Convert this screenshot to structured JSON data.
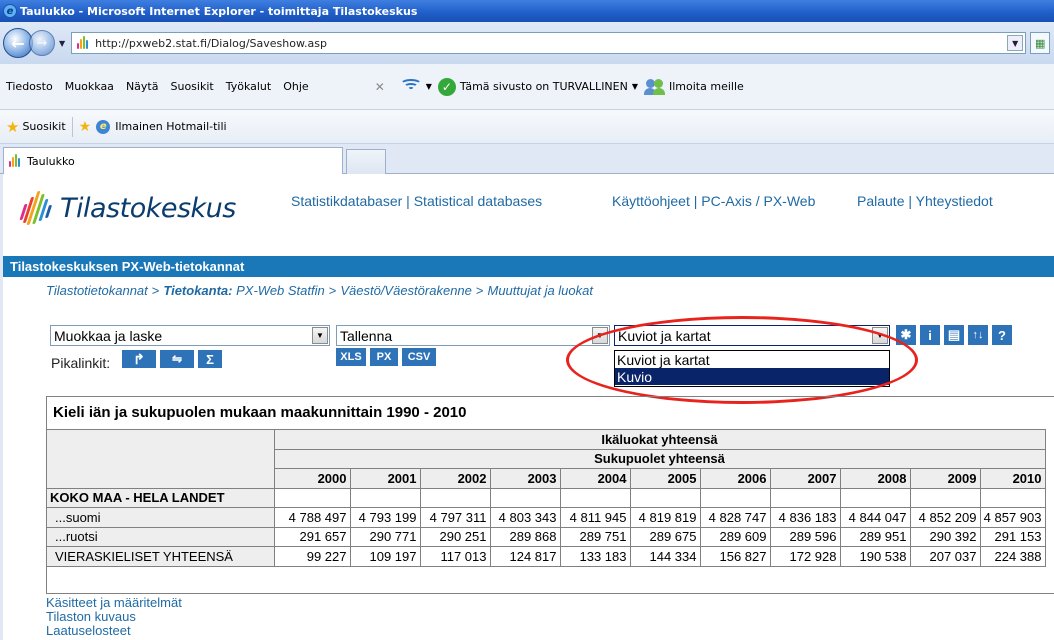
{
  "window": {
    "title": "Taulukko - Microsoft Internet Explorer - toimittaja Tilastokeskus"
  },
  "address": {
    "url": "http://pxweb2.stat.fi/Dialog/Saveshow.asp"
  },
  "menu": {
    "items": [
      "Tiedosto",
      "Muokkaa",
      "Näytä",
      "Suosikit",
      "Työkalut",
      "Ohje"
    ],
    "security_text": "Tämä sivusto on TURVALLINEN",
    "report_text": "Ilmoita meille"
  },
  "favorites": {
    "label": "Suosikit",
    "hotmail": "Ilmainen Hotmail-tili"
  },
  "tab": {
    "label": "Taulukko"
  },
  "site": {
    "logo": "Tilastokeskus",
    "links": {
      "statdb": "Statistikdatabaser",
      "statdb_en": "Statistical databases",
      "help": "Käyttöohjeet",
      "pcaxis": "PC-Axis / PX-Web",
      "feedback": "Palaute",
      "contact": "Yhteystiedot"
    },
    "banner": "Tilastokeskuksen PX-Web-tietokannat",
    "breadcrumb": {
      "a": "Tilastotietokannat",
      "b_label": "Tietokanta:",
      "b_value": "PX-Web Statfin",
      "c": "Väestö/Väestörakenne",
      "d": "Muuttujat ja luokat",
      "sep": ">"
    }
  },
  "controls": {
    "edit_select": "Muokkaa ja laske",
    "save_select": "Tallenna",
    "chart_select": "Kuviot ja kartat",
    "chart_options": [
      "Kuviot ja kartat",
      "Kuvio"
    ],
    "quicklinks_label": "Pikalinkit:",
    "save_buttons": [
      "XLS",
      "PX",
      "CSV"
    ],
    "sum_icon": "Σ"
  },
  "table": {
    "title": "Kieli iän ja sukupuolen mukaan maakunnittain 1990 - 2010",
    "header1": "Ikäluokat yhteensä",
    "header2": "Sukupuolet yhteensä",
    "years": [
      "2000",
      "2001",
      "2002",
      "2003",
      "2004",
      "2005",
      "2006",
      "2007",
      "2008",
      "2009",
      "2010"
    ],
    "region": "KOKO MAA - HELA LANDET",
    "rows": [
      {
        "label": "...suomi",
        "values": [
          "4 788 497",
          "4 793 199",
          "4 797 311",
          "4 803 343",
          "4 811 945",
          "4 819 819",
          "4 828 747",
          "4 836 183",
          "4 844 047",
          "4 852 209",
          "4 857 903"
        ]
      },
      {
        "label": "...ruotsi",
        "values": [
          "291 657",
          "290 771",
          "290 251",
          "289 868",
          "289 751",
          "289 675",
          "289 609",
          "289 596",
          "289 951",
          "290 392",
          "291 153"
        ]
      },
      {
        "label": "VIERASKIELISET YHTEENSÄ",
        "values": [
          "99 227",
          "109 197",
          "117 013",
          "124 817",
          "133 183",
          "144 334",
          "156 827",
          "172 928",
          "190 538",
          "207 037",
          "224 388"
        ]
      }
    ]
  },
  "footer_links": [
    "Käsitteet ja määritelmät",
    "Tilaston kuvaus",
    "Laatuselosteet"
  ],
  "colors": {
    "banner": "#1b78b8",
    "link": "#1f6aa5",
    "highlight": "#0a246a",
    "annotation": "#e8231d"
  }
}
